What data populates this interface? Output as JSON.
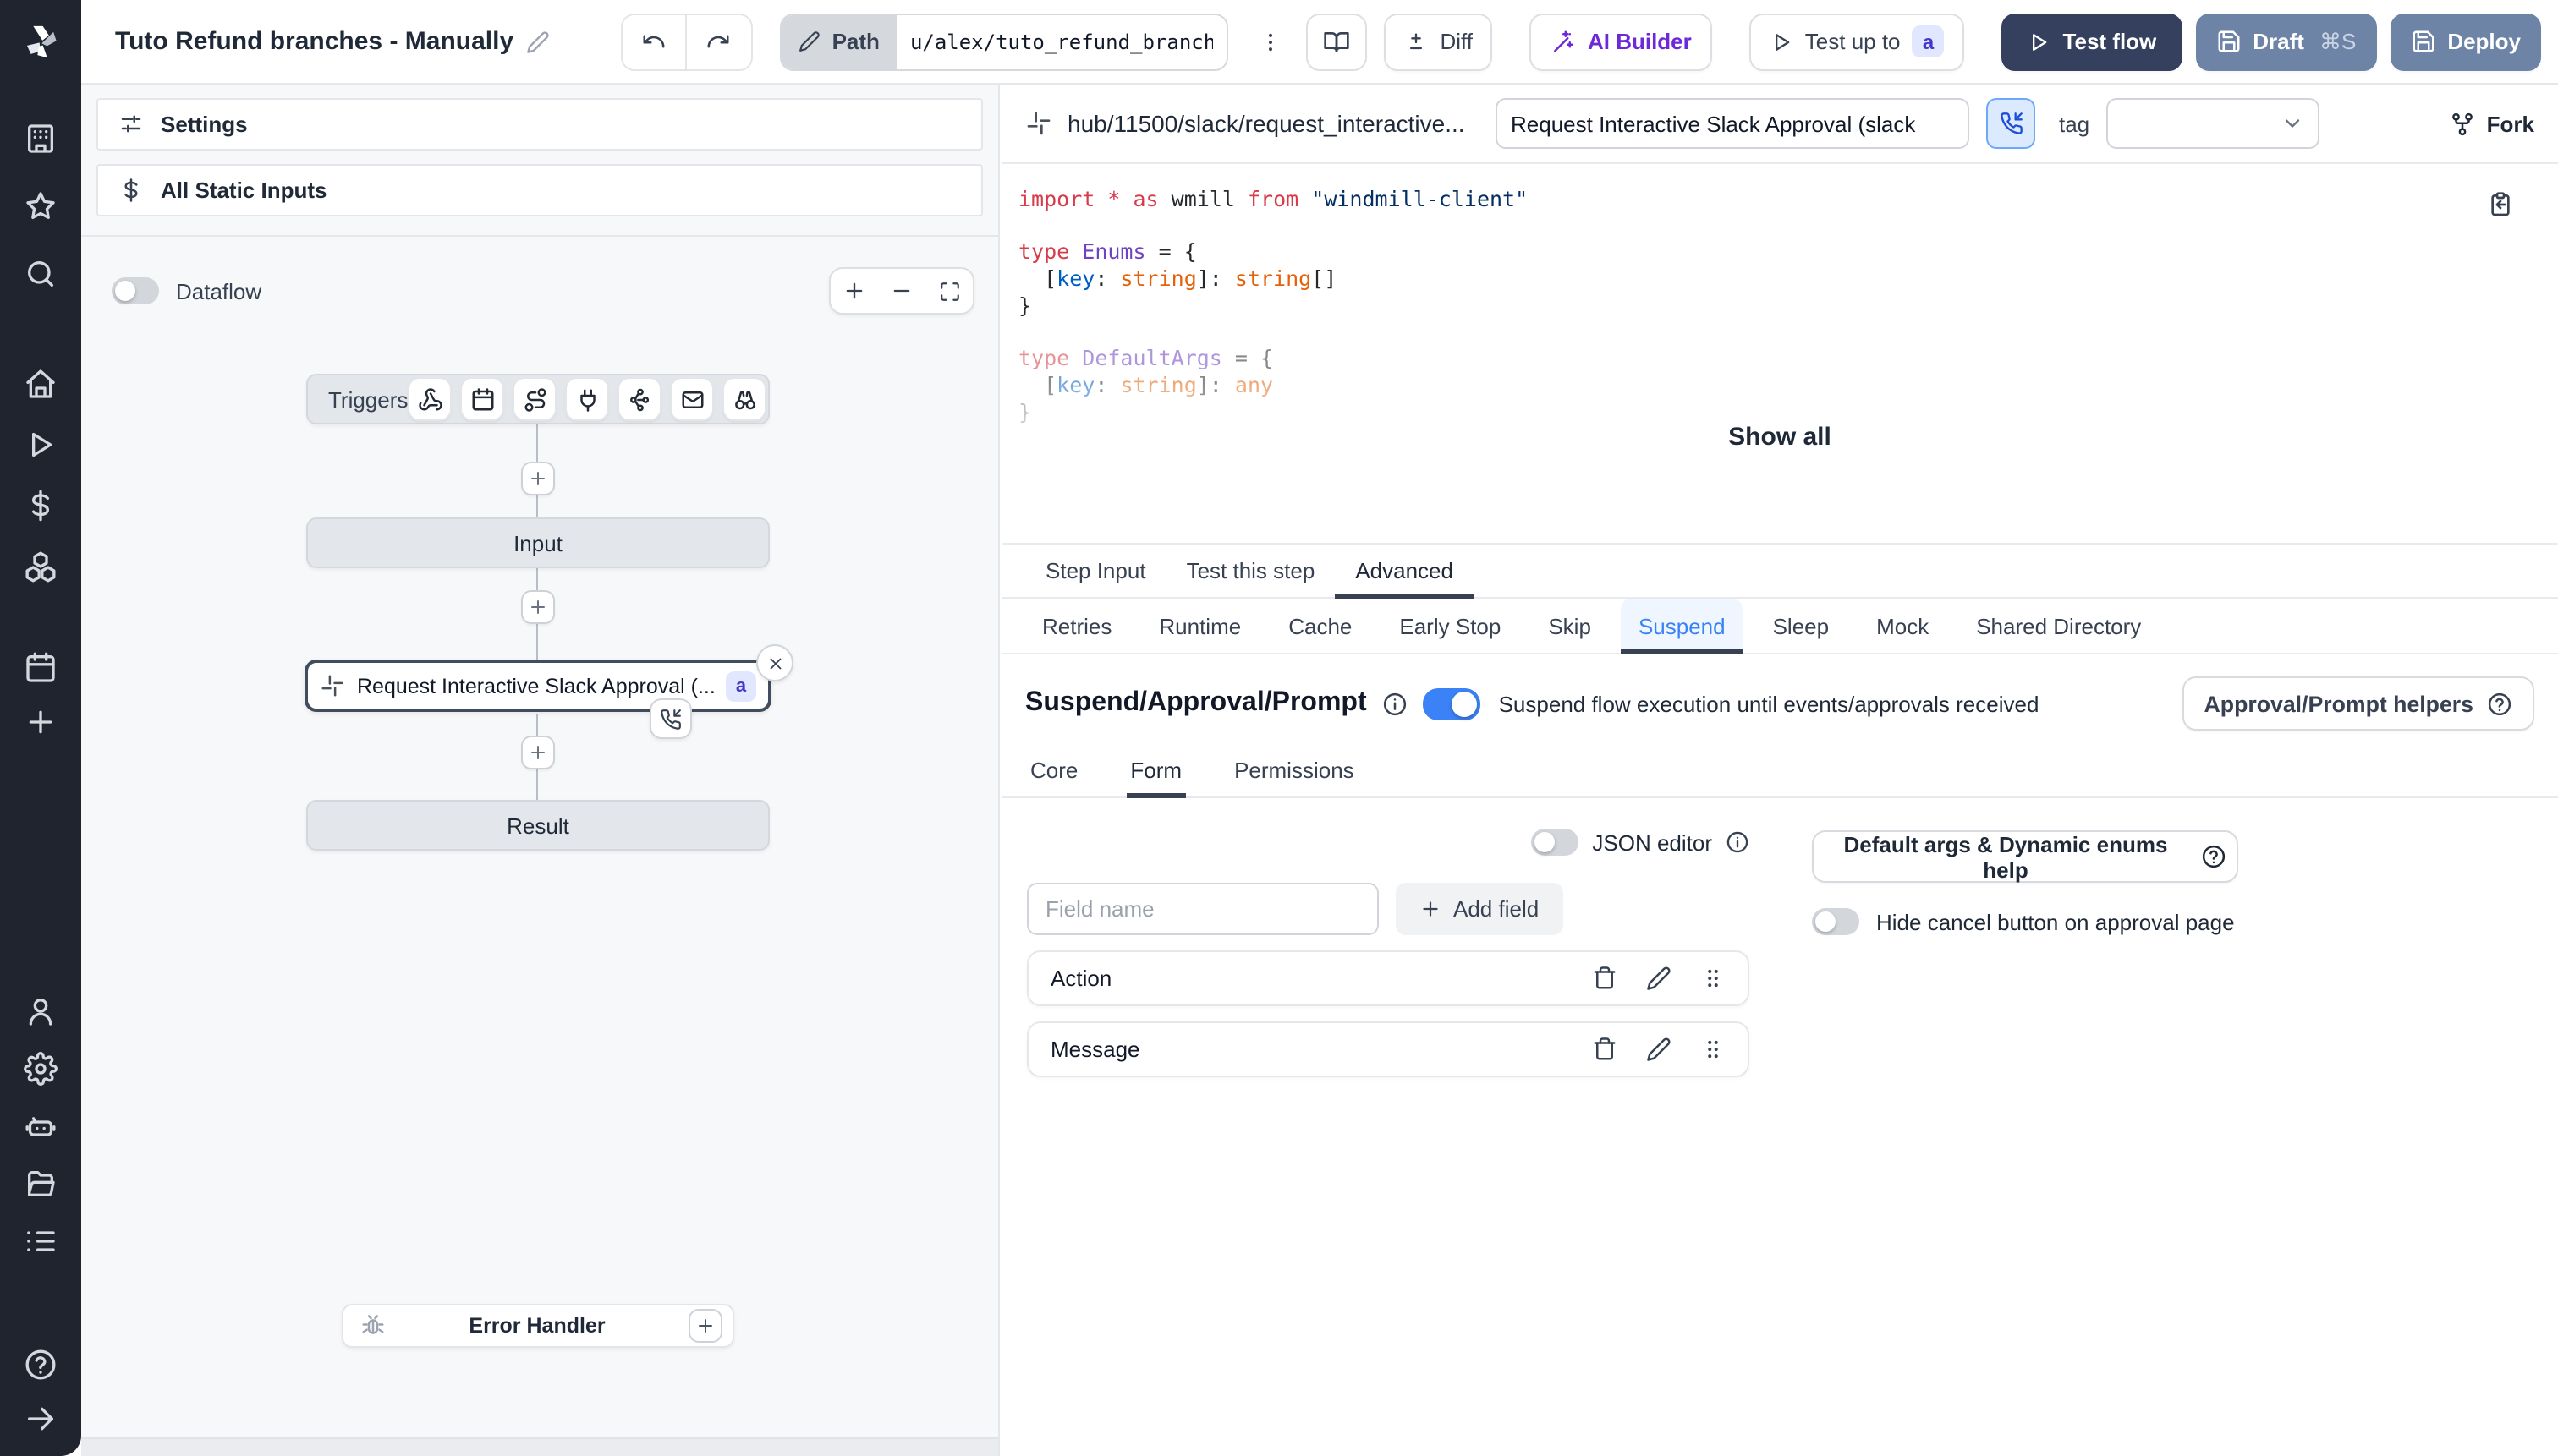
{
  "topbar": {
    "title": "Tuto Refund branches - Manually",
    "path_label": "Path",
    "path_value": "u/alex/tuto_refund_branches__",
    "diff_label": "Diff",
    "ai_builder_label": "AI Builder",
    "test_up_to_label": "Test up to",
    "test_up_to_badge": "a",
    "test_flow_label": "Test flow",
    "draft_label": "Draft",
    "draft_shortcut": "⌘S",
    "deploy_label": "Deploy"
  },
  "sidebar": {
    "top_items": [
      {
        "name": "workspace",
        "icon": "building"
      },
      {
        "name": "favorites",
        "icon": "star"
      },
      {
        "name": "search",
        "icon": "search"
      }
    ],
    "mid_items": [
      {
        "name": "home",
        "icon": "home"
      },
      {
        "name": "runs",
        "icon": "play"
      },
      {
        "name": "variables",
        "icon": "dollar"
      },
      {
        "name": "resources",
        "icon": "boxes"
      }
    ],
    "mid2_items": [
      {
        "name": "schedules",
        "icon": "calendar"
      },
      {
        "name": "create",
        "icon": "plus"
      }
    ],
    "account_items": [
      {
        "name": "user",
        "icon": "user"
      },
      {
        "name": "settings",
        "icon": "gear"
      },
      {
        "name": "ai",
        "icon": "robot"
      },
      {
        "name": "folders",
        "icon": "folder"
      },
      {
        "name": "workers",
        "icon": "list"
      }
    ],
    "bottom_items": [
      {
        "name": "help",
        "icon": "help"
      },
      {
        "name": "collapse",
        "icon": "arrow-right"
      }
    ]
  },
  "flow_panel": {
    "settings_label": "Settings",
    "static_inputs_label": "All Static Inputs",
    "dataflow_label": "Dataflow",
    "triggers_label": "Triggers",
    "trigger_icons": [
      "webhook",
      "calendar",
      "route",
      "plug",
      "kafka",
      "mail",
      "binoculars"
    ],
    "input_label": "Input",
    "approval_label": "Request Interactive Slack Approval (...",
    "approval_badge": "a",
    "result_label": "Result",
    "error_handler_label": "Error Handler"
  },
  "step_panel": {
    "hub_path": "hub/11500/slack/request_interactive...",
    "summary_value": "Request Interactive Slack Approval (slack",
    "tag_label": "tag",
    "fork_label": "Fork",
    "show_all_label": "Show all",
    "code": {
      "lines": [
        {
          "fade": 0,
          "tokens": [
            [
              "kw",
              "import"
            ],
            [
              "pl",
              " "
            ],
            [
              "kw",
              "*"
            ],
            [
              "pl",
              " "
            ],
            [
              "kw",
              "as"
            ],
            [
              "pl",
              " wmill "
            ],
            [
              "kw",
              "from"
            ],
            [
              "pl",
              " "
            ],
            [
              "str",
              "\"windmill-client\""
            ]
          ]
        },
        {
          "fade": 0,
          "tokens": []
        },
        {
          "fade": 0,
          "tokens": [
            [
              "kw",
              "type"
            ],
            [
              "pl",
              " "
            ],
            [
              "ty",
              "Enums"
            ],
            [
              "pl",
              " = {"
            ]
          ]
        },
        {
          "fade": 0,
          "tokens": [
            [
              "pl",
              "  ["
            ],
            [
              "pr",
              "key"
            ],
            [
              "pl",
              ": "
            ],
            [
              "bi",
              "string"
            ],
            [
              "pl",
              "]: "
            ],
            [
              "bi",
              "string"
            ],
            [
              "pl",
              "[]"
            ]
          ]
        },
        {
          "fade": 0,
          "tokens": [
            [
              "pl",
              "}"
            ]
          ]
        },
        {
          "fade": 0,
          "tokens": []
        },
        {
          "fade": 1,
          "tokens": [
            [
              "kw",
              "type"
            ],
            [
              "pl",
              " "
            ],
            [
              "ty",
              "DefaultArgs"
            ],
            [
              "pl",
              " = {"
            ]
          ]
        },
        {
          "fade": 1,
          "tokens": [
            [
              "pl",
              "  ["
            ],
            [
              "pr",
              "key"
            ],
            [
              "pl",
              ": "
            ],
            [
              "bi",
              "string"
            ],
            [
              "pl",
              "]: "
            ],
            [
              "bi",
              "any"
            ]
          ]
        },
        {
          "fade": 2,
          "tokens": [
            [
              "pl",
              "}"
            ]
          ]
        }
      ]
    },
    "tabs": [
      {
        "label": "Step Input",
        "active": false
      },
      {
        "label": "Test this step",
        "active": false
      },
      {
        "label": "Advanced",
        "active": true
      }
    ],
    "advanced_tabs": [
      {
        "label": "Retries",
        "active": false
      },
      {
        "label": "Runtime",
        "active": false
      },
      {
        "label": "Cache",
        "active": false
      },
      {
        "label": "Early Stop",
        "active": false
      },
      {
        "label": "Skip",
        "active": false
      },
      {
        "label": "Suspend",
        "active": true
      },
      {
        "label": "Sleep",
        "active": false
      },
      {
        "label": "Mock",
        "active": false
      },
      {
        "label": "Shared Directory",
        "active": false
      }
    ],
    "suspend": {
      "heading": "Suspend/Approval/Prompt",
      "toggle_on": true,
      "caption": "Suspend flow execution until events/approvals received",
      "helpers_label": "Approval/Prompt helpers",
      "inner_tabs": [
        {
          "label": "Core",
          "active": false
        },
        {
          "label": "Form",
          "active": true
        },
        {
          "label": "Permissions",
          "active": false
        }
      ],
      "json_editor_label": "JSON editor",
      "field_name_placeholder": "Field name",
      "add_field_label": "Add field",
      "default_args_label": "Default args & Dynamic enums help",
      "hide_cancel_label": "Hide cancel button on approval page",
      "fields": [
        {
          "name": "Action"
        },
        {
          "name": "Message"
        }
      ]
    }
  },
  "colors": {
    "accent_blue": "#3b82f6",
    "dark_button": "#353f5e",
    "slate_button": "#6d84a7",
    "badge_bg": "#e0e7ff",
    "badge_text": "#4338ca",
    "sidebar_bg": "#1f242e",
    "ai_purple": "#6d28d9"
  }
}
